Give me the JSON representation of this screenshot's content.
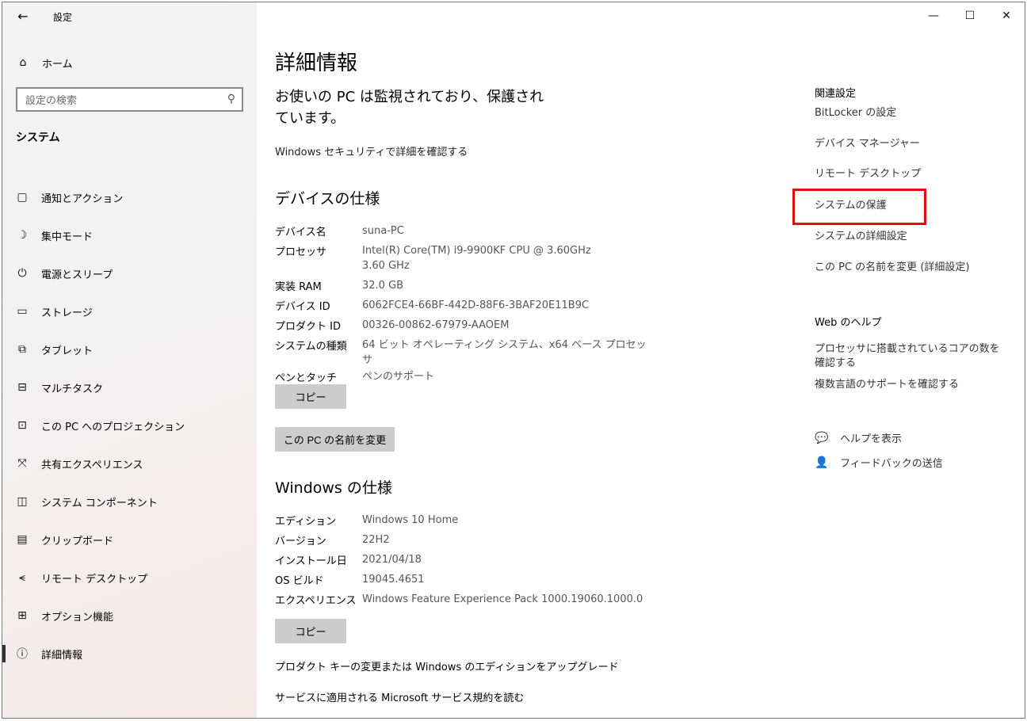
{
  "titlebar": {
    "back_icon": "←",
    "title": "設定"
  },
  "window_controls": {
    "minimize": "—",
    "maximize": "☐",
    "close": "✕"
  },
  "sidebar": {
    "home_label": "ホーム",
    "search_placeholder": "設定の検索",
    "section": "システム",
    "items": [
      {
        "label": "通知とアクション",
        "icon": "notification-icon",
        "glyph": "▢"
      },
      {
        "label": "集中モード",
        "icon": "moon-icon",
        "glyph": "☽"
      },
      {
        "label": "電源とスリープ",
        "icon": "power-icon",
        "glyph": "⏻"
      },
      {
        "label": "ストレージ",
        "icon": "storage-icon",
        "glyph": "▭"
      },
      {
        "label": "タブレット",
        "icon": "tablet-icon",
        "glyph": "⧉"
      },
      {
        "label": "マルチタスク",
        "icon": "multitask-icon",
        "glyph": "⊟"
      },
      {
        "label": "この PC へのプロジェクション",
        "icon": "projection-icon",
        "glyph": "⊡"
      },
      {
        "label": "共有エクスペリエンス",
        "icon": "share-icon",
        "glyph": "⤧"
      },
      {
        "label": "システム コンポーネント",
        "icon": "component-icon",
        "glyph": "◫"
      },
      {
        "label": "クリップボード",
        "icon": "clipboard-icon",
        "glyph": "📋"
      },
      {
        "label": "リモート デスクトップ",
        "icon": "remote-icon",
        "glyph": "⪪"
      },
      {
        "label": "オプション機能",
        "icon": "options-icon",
        "glyph": "⊞"
      },
      {
        "label": "詳細情報",
        "icon": "info-icon",
        "glyph": "ⓘ",
        "active": true
      }
    ]
  },
  "main": {
    "title": "詳細情報",
    "protect_msg": "お使いの PC は監視されており、保護されています。",
    "security_link": "Windows セキュリティで詳細を確認する",
    "device_heading": "デバイスの仕様",
    "device_specs": [
      {
        "key": "デバイス名",
        "value": "suna-PC"
      },
      {
        "key": "プロセッサ",
        "value": "Intel(R) Core(TM) i9-9900KF CPU @ 3.60GHz   3.60 GHz"
      },
      {
        "key": "実装 RAM",
        "value": "32.0 GB"
      },
      {
        "key": "デバイス ID",
        "value": "6062FCE4-66BF-442D-88F6-3BAF20E11B9C"
      },
      {
        "key": "プロダクト ID",
        "value": "00326-00862-67979-AAOEM"
      },
      {
        "key": "システムの種類",
        "value": "64 ビット オペレーティング システム、x64 ベース プロセッサ"
      },
      {
        "key": "ペンとタッチ",
        "value": "ペンのサポート"
      }
    ],
    "copy_label": "コピー",
    "rename_label": "この PC の名前を変更",
    "windows_heading": "Windows の仕様",
    "windows_specs": [
      {
        "key": "エディション",
        "value": "Windows 10 Home"
      },
      {
        "key": "バージョン",
        "value": "22H2"
      },
      {
        "key": "インストール日",
        "value": "2021/04/18"
      },
      {
        "key": "OS ビルド",
        "value": "19045.4651"
      },
      {
        "key": "エクスペリエンス",
        "value": "Windows Feature Experience Pack 1000.19060.1000.0"
      }
    ],
    "copy2_label": "コピー",
    "upgrade_link": "プロダクト キーの変更または Windows のエディションをアップグレード",
    "terms_link": "サービスに適用される Microsoft サービス規約を読む"
  },
  "right": {
    "related_heading": "関連設定",
    "related_links": [
      "BitLocker の設定",
      "デバイス マネージャー",
      "リモート デスクトップ",
      "システムの保護",
      "システムの詳細設定",
      "この PC の名前を変更 (詳細設定)"
    ],
    "web_help_heading": "Web のヘルプ",
    "web_links": [
      "プロセッサに搭載されているコアの数を確認する",
      "複数言語のサポートを確認する"
    ],
    "help_label": "ヘルプを表示",
    "feedback_label": "フィードバックの送信",
    "highlight_color": "#e0100a"
  }
}
